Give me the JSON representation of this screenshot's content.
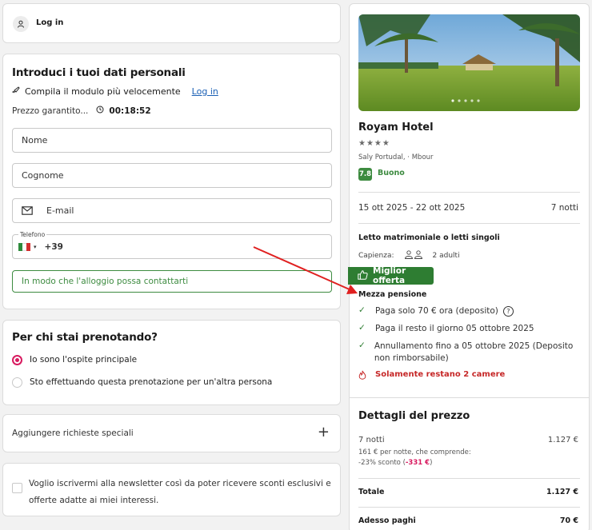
{
  "login": {
    "label": "Log in"
  },
  "personal": {
    "title": "Introduci i tuoi dati personali",
    "quick_text": "Compila il modulo più velocemente",
    "quick_link": "Log in",
    "price_text": "Prezzo garantito...",
    "timer": "00:18:52",
    "first_name_placeholder": "Nome",
    "last_name_placeholder": "Cognome",
    "email_placeholder": "E-mail",
    "phone_label": "Telefono",
    "phone_prefix": "+39",
    "phone_hint": "In modo che l'alloggio possa contattarti"
  },
  "booking": {
    "title": "Per chi stai prenotando?",
    "options": [
      {
        "label": "Io sono l'ospite principale",
        "selected": true
      },
      {
        "label": "Sto effettuando questa prenotazione per un'altra persona",
        "selected": false
      }
    ]
  },
  "special": {
    "label": "Aggiungere richieste speciali"
  },
  "newsletter": {
    "text": "Voglio iscrivermi alla newsletter così da poter ricevere sconti esclusivi e offerte adatte ai miei interessi."
  },
  "hotel": {
    "name": "Royam Hotel",
    "stars": "★★★★",
    "location": "Saly Portudal, · Mbour",
    "score": "7.8",
    "score_label": "Buono",
    "dates": "15 ott 2025 - 22 ott 2025",
    "nights": "7 notti",
    "room": "Letto matrimoniale o letti singoli",
    "capacity_label": "Capienza:",
    "capacity_value": "2 adulti",
    "best_offer": "Miglior offerta",
    "board": "Mezza pensione",
    "conditions": [
      "Paga solo 70 € ora (deposito)",
      "Paga il resto il giorno 05 ottobre 2025",
      "Annullamento fino a 05 ottobre 2025 (Deposito non rimborsabile)"
    ],
    "scarcity": "Solamente restano 2 camere"
  },
  "price": {
    "title": "Dettagli del prezzo",
    "nights_label": "7 notti",
    "nights_value": "1.127 €",
    "per_night": "161 € per notte, che comprende:",
    "discount_text": "-23% sconto (",
    "discount_value": "-331 €",
    "discount_close": ")",
    "total_label": "Totale",
    "total_value": "1.127 €",
    "pay_now_label": "Adesso paghi",
    "pay_now_value": "70 €"
  },
  "colors": {
    "accent_green": "#2e7d32",
    "link_blue": "#1a5fb4",
    "alert_red": "#c62828",
    "radio_pink": "#d81b60"
  }
}
